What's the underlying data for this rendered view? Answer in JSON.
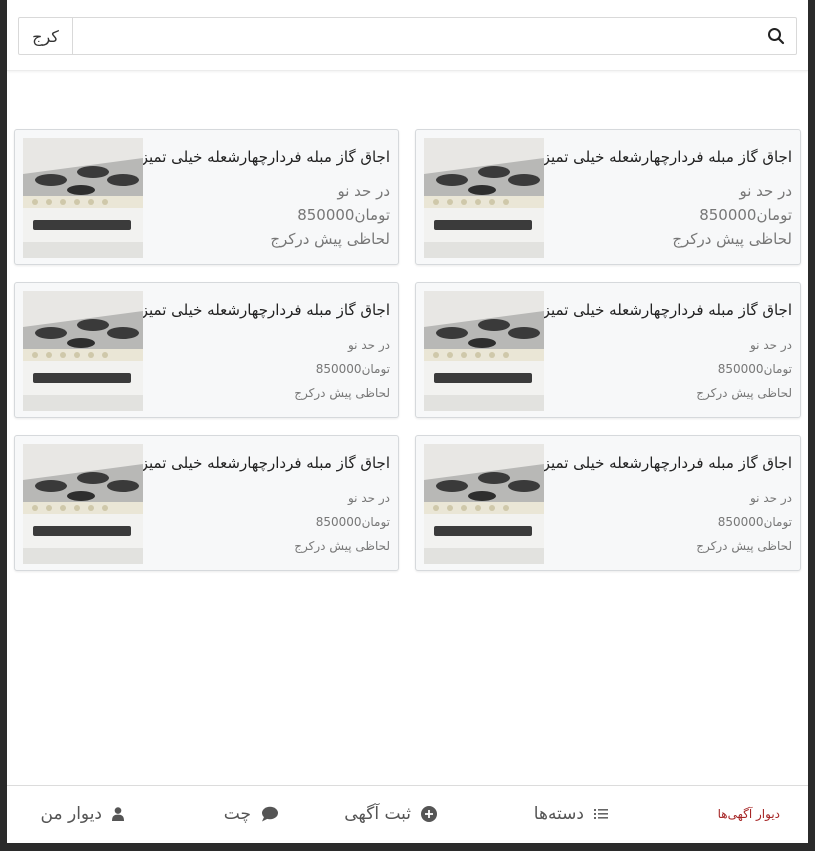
{
  "search": {
    "city": "کرج",
    "placeholder": "",
    "value": ""
  },
  "listings": [
    {
      "title": "اجاق گاز مبله فردارچهارشعله خیلی تمیز",
      "condition": "در حد نو",
      "price": "تومان850000",
      "time_location": "لحاظی پیش درکرج"
    },
    {
      "title": "اجاق گاز مبله فردارچهارشعله خیلی تمیز",
      "condition": "در حد نو",
      "price": "تومان850000",
      "time_location": "لحاظی پیش درکرج"
    },
    {
      "title": "اجاق گاز مبله فردارچهارشعله خیلی تمیز",
      "condition": "در حد نو",
      "price": "تومان850000",
      "time_location": "لحاظی پیش درکرج"
    },
    {
      "title": "اجاق گاز مبله فردارچهارشعله خیلی تمیز",
      "condition": "در حد نو",
      "price": "تومان850000",
      "time_location": "لحاظی پیش درکرج"
    },
    {
      "title": "اجاق گاز مبله فردارچهارشعله خیلی تمیز",
      "condition": "در حد نو",
      "price": "تومان850000",
      "time_location": "لحاظی پیش درکرج"
    },
    {
      "title": "اجاق گاز مبله فردارچهارشعله خیلی تمیز",
      "condition": "در حد نو",
      "price": "تومان850000",
      "time_location": "لحاظی پیش درکرج"
    }
  ],
  "nav": {
    "wall": "دیوار آگهی‌ها",
    "categories": "دسته‌ها",
    "post_ad": "ثبت آگهی",
    "chat": "چت",
    "my_divar": "دیوار من"
  },
  "colors": {
    "accent": "#a62626",
    "card_bg": "#f7f8f9",
    "muted_text": "#777777"
  },
  "icons": [
    "search-icon",
    "list-icon",
    "plus-circle-icon",
    "chat-bubble-icon",
    "user-icon"
  ]
}
